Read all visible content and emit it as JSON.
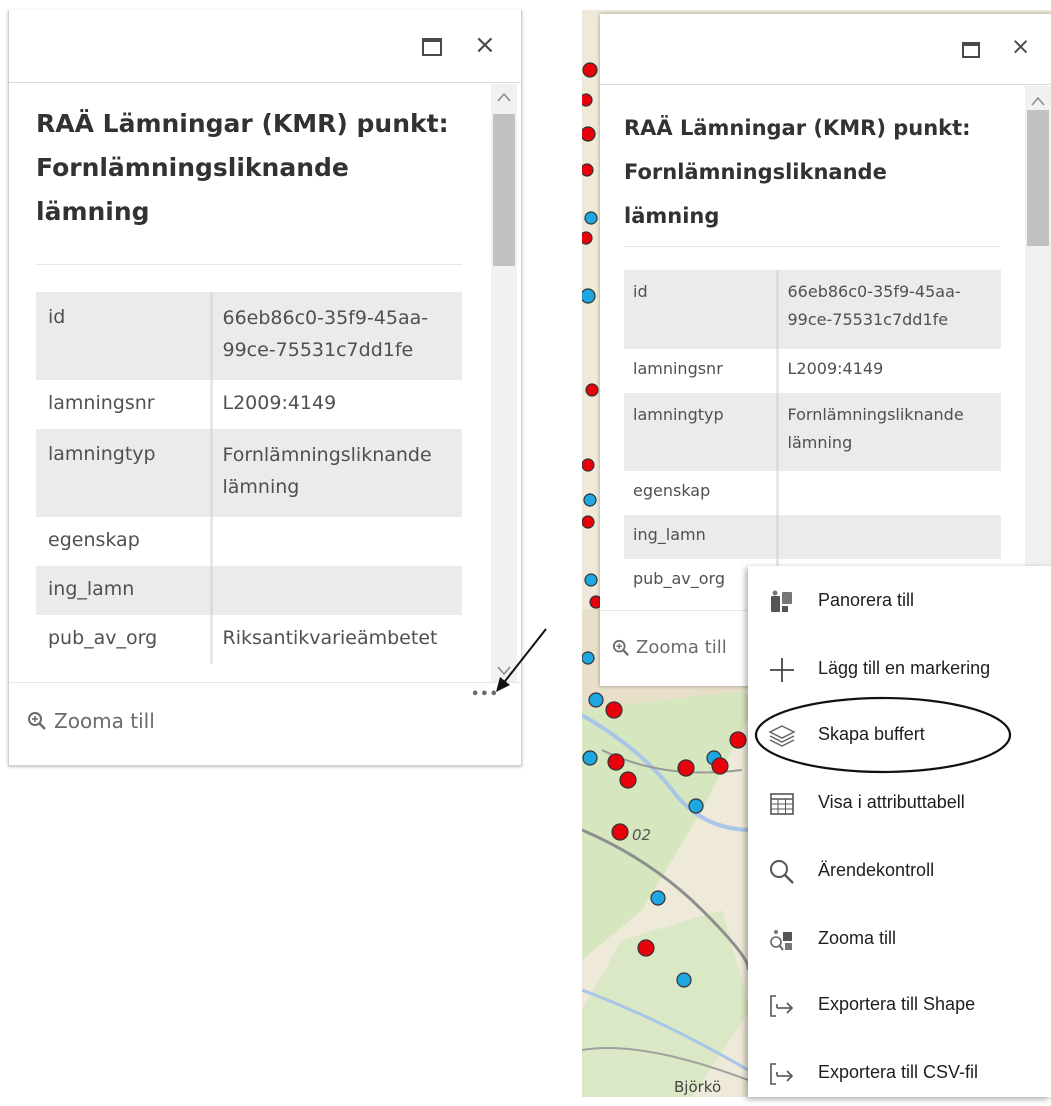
{
  "popup": {
    "title": "RAÄ Lämningar (KMR) punkt: Fornlämningsliknande lämning",
    "title_lines": [
      "RAÄ Lämningar (KMR) punkt:",
      "Fornlämningsliknande",
      "lämning"
    ],
    "maximize_icon": "maximize-icon",
    "close_icon": "close-icon",
    "close_label": "×",
    "rows": [
      {
        "key": "id",
        "value_lines": [
          "66eb86c0-35f9-45aa-",
          "99ce-75531c7dd1fe"
        ]
      },
      {
        "key": "lamningsnr",
        "value_lines": [
          "L2009:4149"
        ]
      },
      {
        "key": "lamningtyp",
        "value_lines": [
          "Fornlämningsliknande",
          "lämning"
        ]
      },
      {
        "key": "egenskap",
        "value_lines": [
          ""
        ]
      },
      {
        "key": "ing_lamn",
        "value_lines": [
          ""
        ]
      },
      {
        "key": "pub_av_org",
        "value_lines": [
          "Riksantikvarieämbetet"
        ]
      }
    ],
    "zoom_label": "Zooma till",
    "zoom_icon": "zoom-in-icon",
    "more_label": "•••"
  },
  "context_menu": {
    "items": [
      {
        "label": "Panorera till",
        "icon": "pan-to-icon"
      },
      {
        "label": "Lägg till en markering",
        "icon": "plus-icon"
      },
      {
        "label": "Skapa buffert",
        "icon": "layers-icon"
      },
      {
        "label": "Visa i attributtabell",
        "icon": "table-icon"
      },
      {
        "label": "Ärendekontroll",
        "icon": "search-icon"
      },
      {
        "label": "Zooma till",
        "icon": "zoom-to-icon"
      },
      {
        "label": "Exportera till Shape",
        "icon": "export-icon"
      },
      {
        "label": "Exportera till CSV-fil",
        "icon": "export-icon"
      }
    ],
    "highlighted_item": "Skapa buffert"
  },
  "map": {
    "labels": [
      "02",
      "Björkö"
    ],
    "colors": {
      "red_point": "#e8000b",
      "blue_point": "#1ea7e1",
      "water": "#a9c6e8",
      "road": "#888888",
      "forest": "#cfe3b4"
    }
  }
}
